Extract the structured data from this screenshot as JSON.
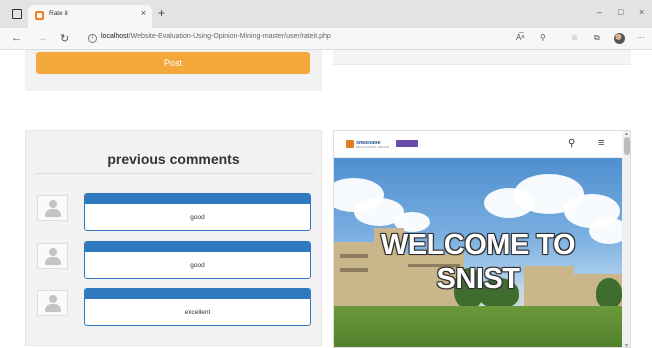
{
  "browser": {
    "tab_title": "Rate it",
    "tab_close": "×",
    "new_tab": "+",
    "url_host": "localhost",
    "url_path": "/Website-Evaluation-Using-Opinion-Mining-master/user/rateit.php",
    "window_controls": [
      "–",
      "□",
      "×"
    ],
    "nav": {
      "back": "←",
      "forward": "→",
      "refresh": "↻"
    },
    "tools": [
      "A͡ᵃ",
      "⚲",
      "☆",
      "☆",
      "⧉",
      "···"
    ]
  },
  "form": {
    "post_label": "Post"
  },
  "comments": {
    "title": "previous comments",
    "items": [
      {
        "text": "good"
      },
      {
        "text": "good"
      },
      {
        "text": "excellent"
      }
    ]
  },
  "preview": {
    "logo_text": "SREENIDHI",
    "logo_sub": "EDUCATIONAL GROUP",
    "hero_line1": "WELCOME TO",
    "hero_line2": "SNIST",
    "search_icon": "search-icon",
    "menu_icon": "hamburger-menu-icon"
  },
  "colors": {
    "post_button": "#f4a73b",
    "comment_bar": "#2f7abf",
    "tab_favicon": "#f37b20"
  }
}
